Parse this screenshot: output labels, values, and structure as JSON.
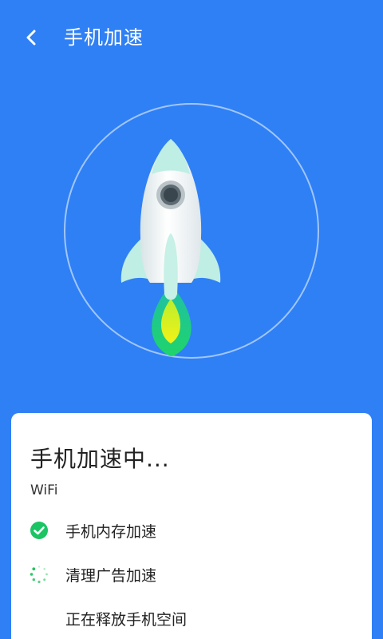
{
  "header": {
    "title": "手机加速",
    "back_icon": "chevron-left-icon"
  },
  "colors": {
    "background": "#2f80f5",
    "card": "#ffffff",
    "done": "#1bc464",
    "progress": "#22c35e"
  },
  "card": {
    "title": "手机加速中...",
    "subtitle": "WiFi",
    "tasks": [
      {
        "label": "手机内存加速",
        "status": "done",
        "icon": "check-circle-icon"
      },
      {
        "label": "清理广告加速",
        "status": "in-progress",
        "icon": "spinner-icon"
      },
      {
        "label": "正在释放手机空间",
        "status": "pending",
        "icon": ""
      }
    ]
  }
}
